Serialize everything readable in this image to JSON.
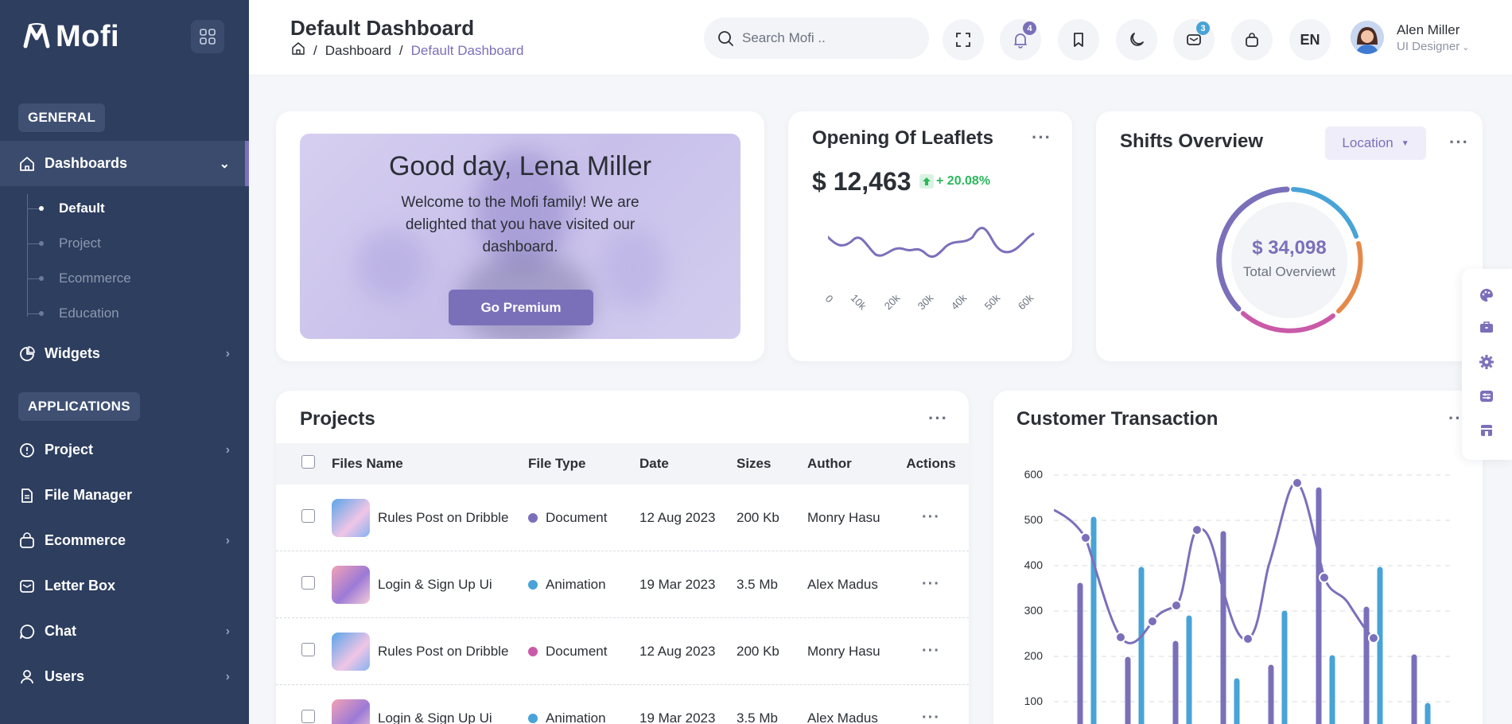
{
  "sidebar": {
    "brand": "Mofi",
    "section_general": "GENERAL",
    "section_applications": "APPLICATIONS",
    "dashboards": "Dashboards",
    "sub_items": [
      "Default",
      "Project",
      "Ecommerce",
      "Education"
    ],
    "widgets": "Widgets",
    "apps": [
      "Project",
      "File Manager",
      "Ecommerce",
      "Letter Box",
      "Chat",
      "Users"
    ]
  },
  "header": {
    "title": "Default Dashboard",
    "breadcrumb": [
      "Dashboard",
      "Default Dashboard"
    ],
    "search_placeholder": "Search Mofi ..",
    "notification_count": "4",
    "message_count": "3",
    "language": "EN",
    "user_name": "Alen Miller",
    "user_role": "UI Designer"
  },
  "welcome": {
    "greeting": "Good day, Lena Miller",
    "message": "Welcome to the Mofi family! We are delighted that you have visited our dashboard.",
    "button": "Go Premium"
  },
  "leaflets": {
    "title": "Opening Of Leaflets",
    "amount": "$ 12,463",
    "change": "+ 20.08%",
    "x_ticks": [
      "0",
      "10k",
      "20k",
      "30k",
      "40k",
      "50k",
      "60k"
    ]
  },
  "shifts": {
    "title": "Shifts Overview",
    "filter": "Location",
    "amount": "$ 34,098",
    "label": "Total Overviewt"
  },
  "projects": {
    "title": "Projects",
    "columns": [
      "Files Name",
      "File Type",
      "Date",
      "Sizes",
      "Author",
      "Actions"
    ],
    "rows": [
      {
        "name": "Rules Post on Dribble",
        "type": "Document",
        "date": "12 Aug 2023",
        "size": "200 Kb",
        "author": "Monry Hasu",
        "type_color": "#7a70ba",
        "thumb": "blue"
      },
      {
        "name": "Login & Sign Up Ui",
        "type": "Animation",
        "date": "19 Mar 2023",
        "size": "3.5 Mb",
        "author": "Alex Madus",
        "type_color": "#48a3d7",
        "thumb": "pink"
      },
      {
        "name": "Rules Post on Dribble",
        "type": "Document",
        "date": "12 Aug 2023",
        "size": "200 Kb",
        "author": "Monry Hasu",
        "type_color": "#c95aa7",
        "thumb": "blue"
      },
      {
        "name": "Login & Sign Up Ui",
        "type": "Animation",
        "date": "19 Mar 2023",
        "size": "3.5 Mb",
        "author": "Alex Madus",
        "type_color": "#48a3d7",
        "thumb": "pink"
      }
    ]
  },
  "transactions": {
    "title": "Customer Transaction",
    "y_ticks": [
      "600",
      "500",
      "400",
      "300",
      "200",
      "100"
    ]
  },
  "colors": {
    "sidebar": "#2d3e5f",
    "primary": "#7a70ba",
    "secondary": "#48a3d7",
    "orange": "#e5894a",
    "pink": "#c95aa7",
    "success": "#2bb85c"
  }
}
